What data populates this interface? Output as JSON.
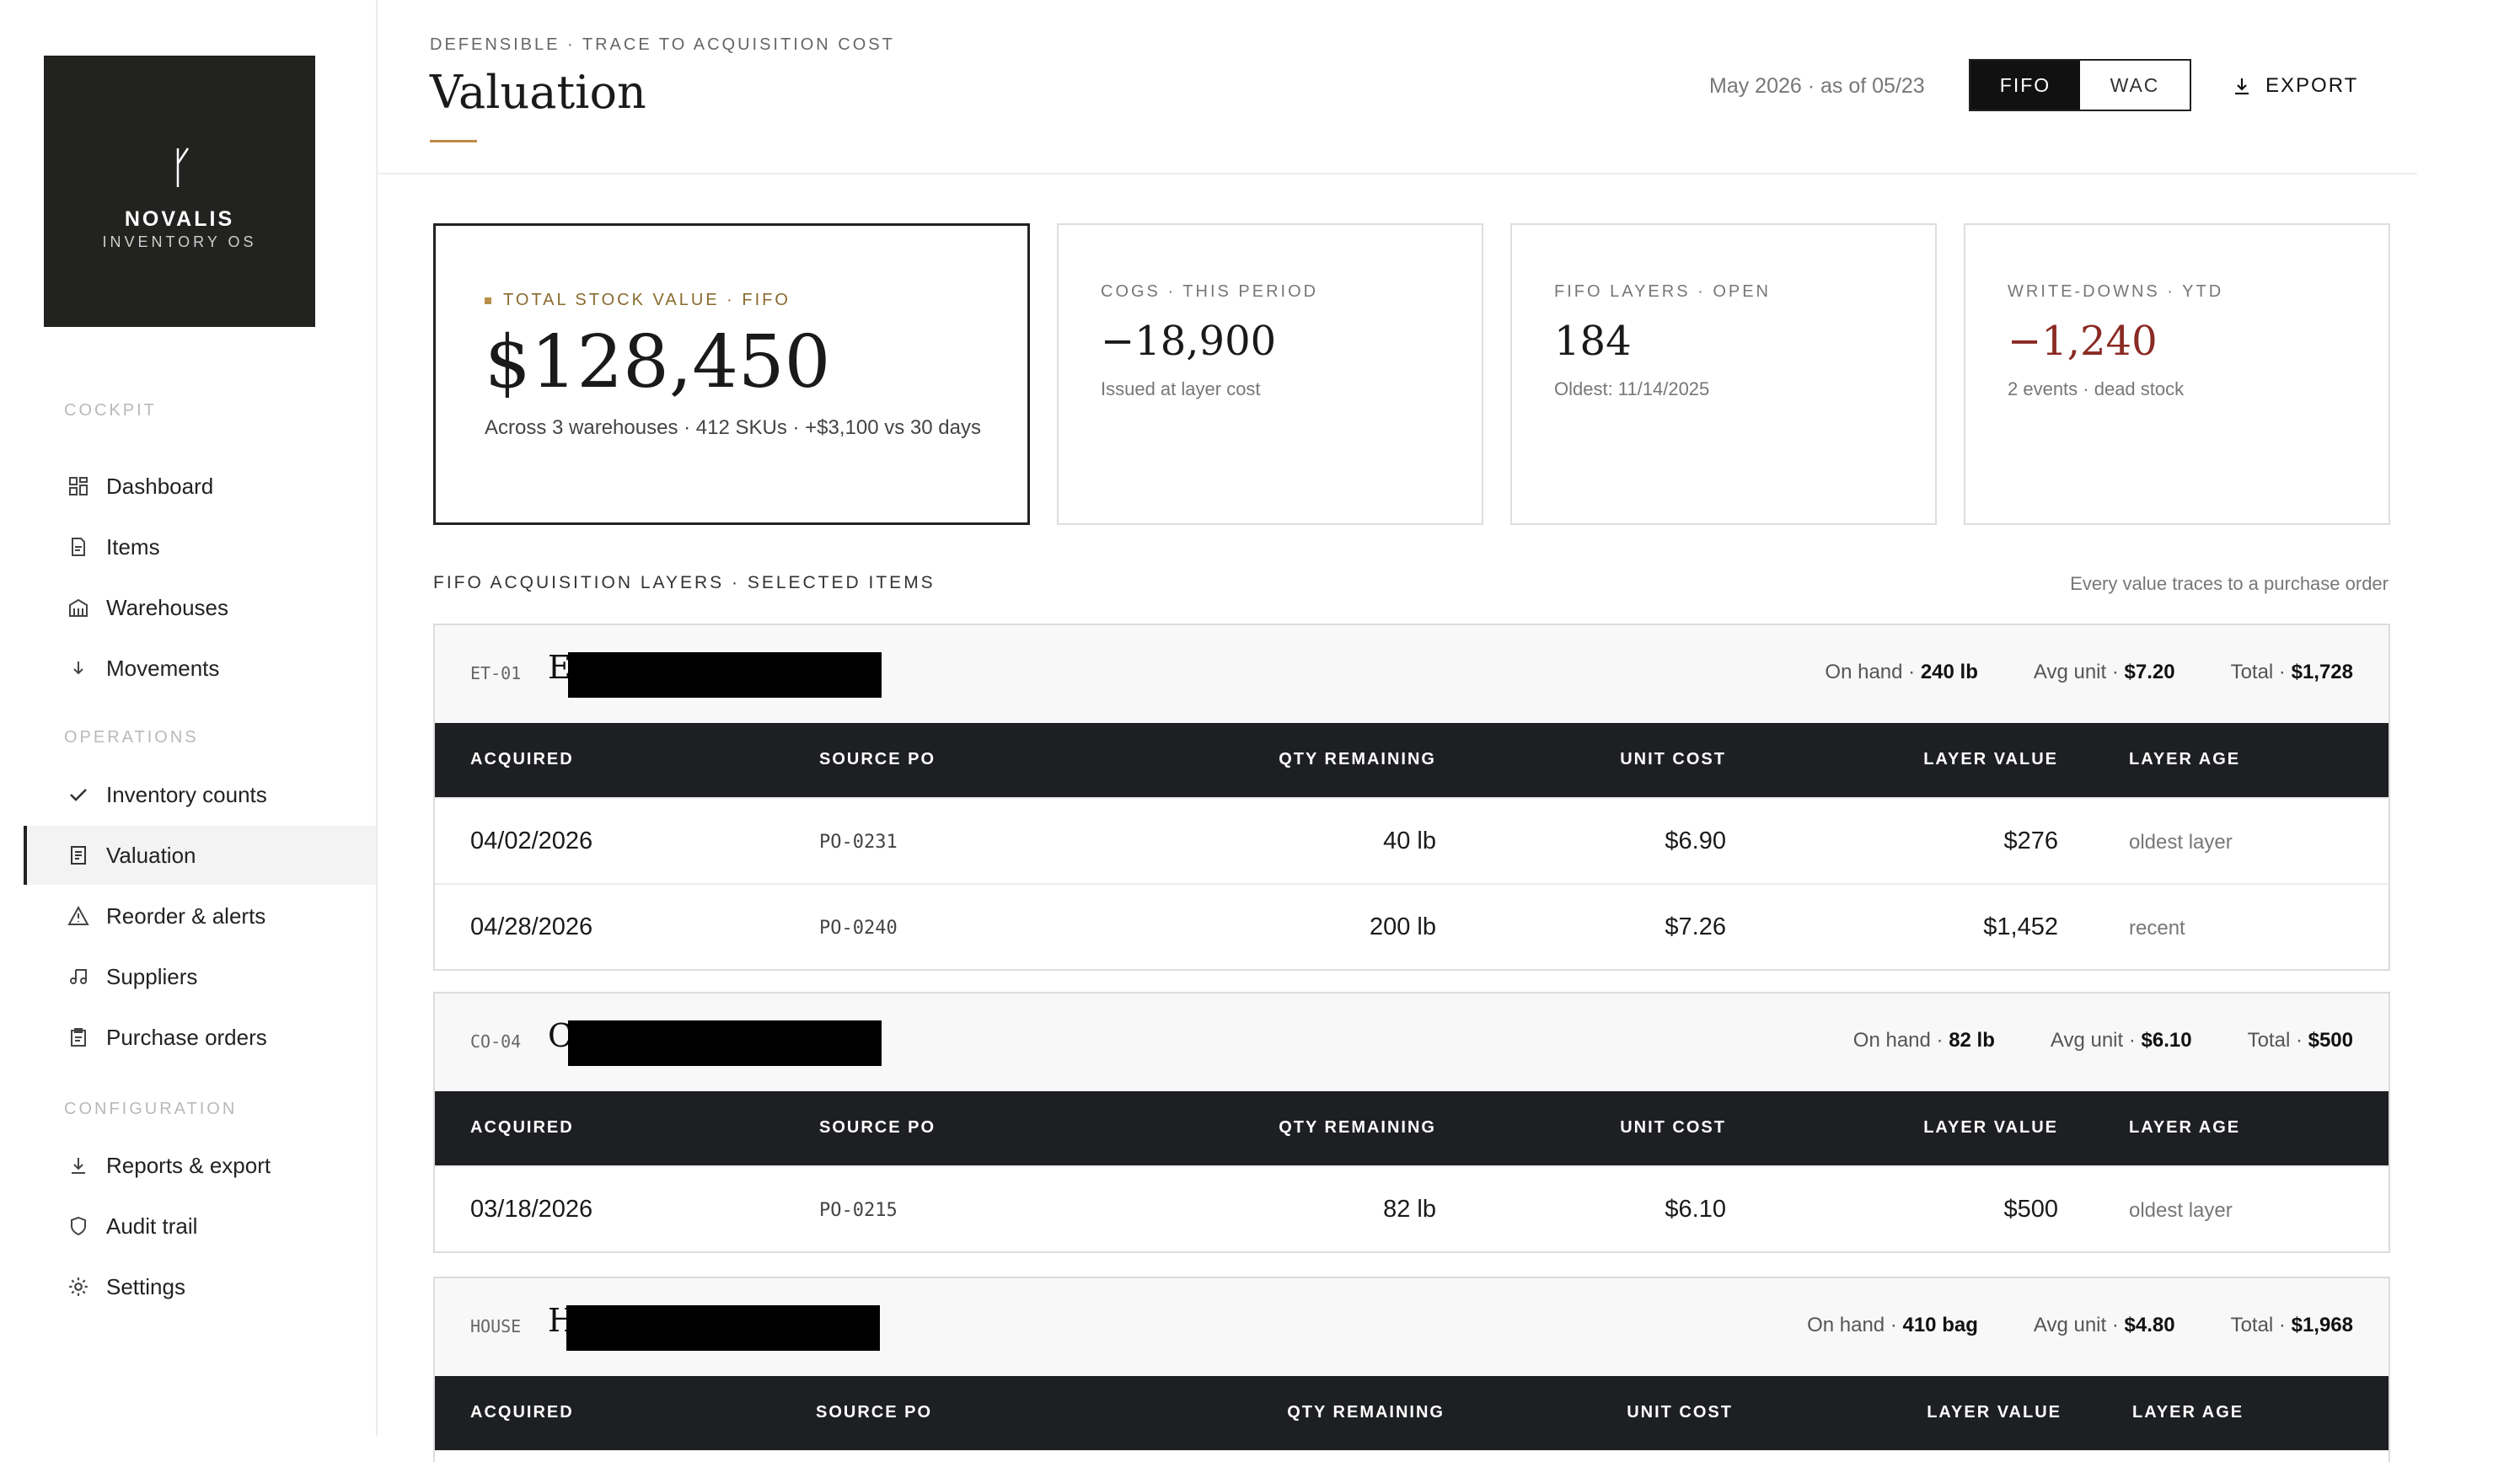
{
  "sidebar": {
    "logo": {
      "name": "NOVALIS",
      "sub": "INVENTORY OS"
    },
    "sections": [
      {
        "label": "COCKPIT",
        "items": [
          {
            "label": "Dashboard",
            "icon": "grid-icon"
          },
          {
            "label": "Items",
            "icon": "document-icon"
          },
          {
            "label": "Warehouses",
            "icon": "warehouse-icon"
          },
          {
            "label": "Movements",
            "icon": "arrow-down-icon"
          }
        ]
      },
      {
        "label": "OPERATIONS",
        "items": [
          {
            "label": "Inventory counts",
            "icon": "check-icon"
          },
          {
            "label": "Valuation",
            "icon": "ledger-icon",
            "active": true
          },
          {
            "label": "Reorder & alerts",
            "icon": "warning-icon"
          },
          {
            "label": "Suppliers",
            "icon": "truck-icon"
          },
          {
            "label": "Purchase orders",
            "icon": "clipboard-icon"
          }
        ]
      },
      {
        "label": "CONFIGURATION",
        "items": [
          {
            "label": "Reports & export",
            "icon": "download-icon"
          },
          {
            "label": "Audit trail",
            "icon": "shield-icon"
          },
          {
            "label": "Settings",
            "icon": "gear-icon"
          }
        ]
      }
    ]
  },
  "header": {
    "eyebrow": "DEFENSIBLE · TRACE TO ACQUISITION COST",
    "title": "Valuation",
    "period": "May 2026 · as of 05/23",
    "method_options": [
      "FIFO",
      "WAC"
    ],
    "method_selected": "FIFO",
    "export_label": "EXPORT"
  },
  "kpis": [
    {
      "label": "TOTAL STOCK VALUE · FIFO",
      "value": "$128,450",
      "note": "Across 3 warehouses · 412 SKUs · +$3,100 vs 30 days"
    },
    {
      "label": "COGS · THIS PERIOD",
      "value": "−18,900",
      "note": "Issued at layer cost"
    },
    {
      "label": "FIFO LAYERS · OPEN",
      "value": "184",
      "note": "Oldest: 11/14/2025"
    },
    {
      "label": "WRITE-DOWNS · YTD",
      "value": "−1,240",
      "note": "2 events · dead stock"
    }
  ],
  "layers": {
    "label": "FIFO ACQUISITION LAYERS · SELECTED ITEMS",
    "note": "Every value traces to a purchase order",
    "columns": [
      "ACQUIRED",
      "SOURCE PO",
      "QTY REMAINING",
      "UNIT COST",
      "LAYER VALUE",
      "LAYER AGE"
    ],
    "stat_labels": {
      "on_hand": "On hand · ",
      "avg_unit": "Avg unit · ",
      "total": "Total · "
    },
    "groups": [
      {
        "sku": "ET-01",
        "name_initial": "E",
        "on_hand": "240 lb",
        "avg_unit": "$7.20",
        "total": "$1,728",
        "rows": [
          {
            "acquired": "04/02/2026",
            "po": "PO-0231",
            "qty": "40 lb",
            "unit_cost": "$6.90",
            "value": "$276",
            "age": "oldest layer"
          },
          {
            "acquired": "04/28/2026",
            "po": "PO-0240",
            "qty": "200 lb",
            "unit_cost": "$7.26",
            "value": "$1,452",
            "age": "recent"
          }
        ]
      },
      {
        "sku": "CO-04",
        "name_initial": "C",
        "on_hand": "82 lb",
        "avg_unit": "$6.10",
        "total": "$500",
        "rows": [
          {
            "acquired": "03/18/2026",
            "po": "PO-0215",
            "qty": "82 lb",
            "unit_cost": "$6.10",
            "value": "$500",
            "age": "oldest layer"
          }
        ]
      },
      {
        "sku": "HOUSE",
        "name_initial": "H",
        "on_hand": "410 bag",
        "avg_unit": "$4.80",
        "total": "$1,968",
        "rows": []
      }
    ]
  }
}
